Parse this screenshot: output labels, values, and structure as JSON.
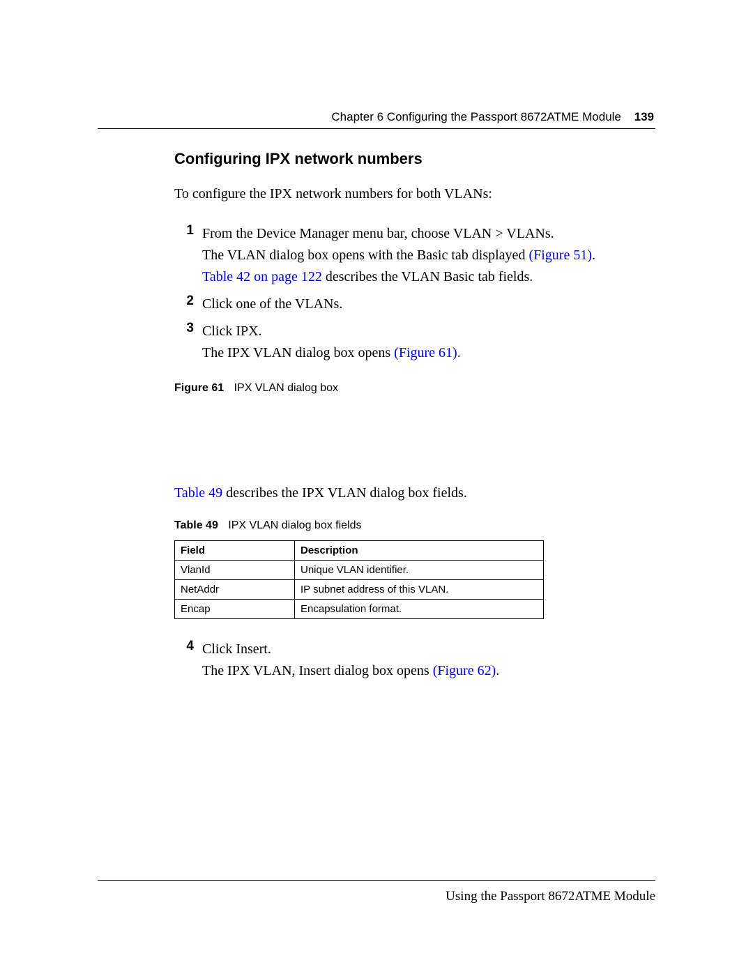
{
  "header": {
    "chapter_line": "Chapter 6  Configuring the Passport 8672ATME Module",
    "page_number": "139"
  },
  "section": {
    "title": "Configuring IPX network numbers",
    "intro": "To configure the IPX network numbers for both VLANs:"
  },
  "steps": {
    "s1": {
      "num": "1",
      "line1": "From the Device Manager menu bar, choose VLAN > VLANs.",
      "line2_prefix": "The VLAN dialog box opens with the Basic tab displayed ",
      "line2_link": "(Figure 51)",
      "line2_suffix": ".",
      "line3_link": "Table 42 on page 122",
      "line3_suffix": " describes the VLAN Basic tab fields."
    },
    "s2": {
      "num": "2",
      "line1": "Click one of the VLANs."
    },
    "s3": {
      "num": "3",
      "line1": "Click IPX.",
      "line2_prefix": "The IPX VLAN dialog box opens ",
      "line2_link": "(Figure 61)",
      "line2_suffix": "."
    },
    "s4": {
      "num": "4",
      "line1": "Click Insert.",
      "line2_prefix": "The IPX VLAN, Insert dialog box opens ",
      "line2_link": "(Figure 62)",
      "line2_suffix": "."
    }
  },
  "figure61": {
    "label": "Figure 61",
    "caption": "IPX VLAN dialog box"
  },
  "after_fig": {
    "link": "Table 49",
    "suffix": " describes the IPX VLAN dialog box fields."
  },
  "table49": {
    "label": "Table 49",
    "caption": "IPX VLAN dialog box fields",
    "col1": "Field",
    "col2": "Description",
    "rows": {
      "r0": {
        "field": "VlanId",
        "desc": "Unique VLAN identifier."
      },
      "r1": {
        "field": "NetAddr",
        "desc": "IP subnet address of this VLAN."
      },
      "r2": {
        "field": "Encap",
        "desc": "Encapsulation format."
      }
    }
  },
  "footer": {
    "text": "Using the Passport 8672ATME Module"
  }
}
